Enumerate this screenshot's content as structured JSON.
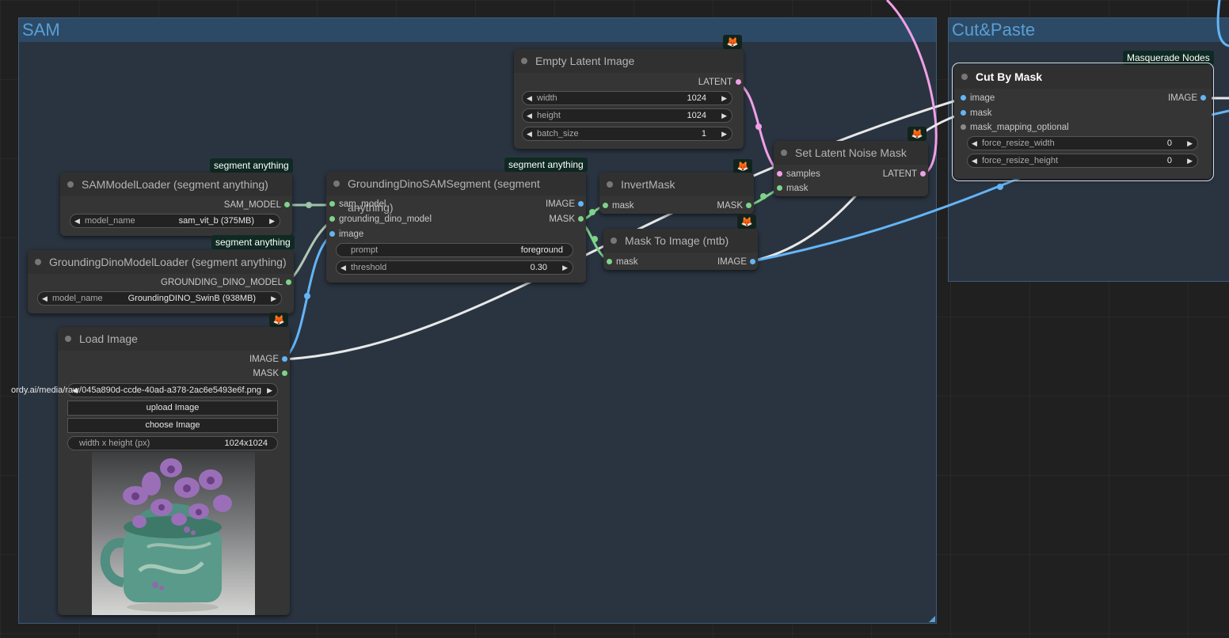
{
  "groups": {
    "sam": {
      "title": "SAM"
    },
    "cutpaste": {
      "title": "Cut&Paste"
    }
  },
  "badges": {
    "segment_anything": "segment anything",
    "masquerade": "Masquerade Nodes"
  },
  "fox_icon": "🦊",
  "arrows": {
    "left": "◀",
    "right": "▶"
  },
  "nodes": {
    "empty_latent": {
      "title": "Empty Latent Image",
      "out_latent": "LATENT",
      "w_width": {
        "label": "width",
        "value": "1024"
      },
      "w_height": {
        "label": "height",
        "value": "1024"
      },
      "w_batch": {
        "label": "batch_size",
        "value": "1"
      }
    },
    "sam_loader": {
      "title": "SAMModelLoader (segment anything)",
      "out": "SAM_MODEL",
      "w_model": {
        "label": "model_name",
        "value": "sam_vit_b (375MB)"
      }
    },
    "dino_loader": {
      "title": "GroundingDinoModelLoader (segment anything)",
      "out": "GROUNDING_DINO_MODEL",
      "w_model": {
        "label": "model_name",
        "value": "GroundingDINO_SwinB (938MB)"
      }
    },
    "dino_sam": {
      "title": "GroundingDinoSAMSegment (segment anything)",
      "in_sam": "sam_model",
      "in_dino": "grounding_dino_model",
      "in_image": "image",
      "out_image": "IMAGE",
      "out_mask": "MASK",
      "w_prompt": {
        "label": "prompt",
        "value": "foreground"
      },
      "w_threshold": {
        "label": "threshold",
        "value": "0.30"
      }
    },
    "invert_mask": {
      "title": "InvertMask",
      "in_mask": "mask",
      "out_mask": "MASK"
    },
    "mask_to_image": {
      "title": "Mask To Image (mtb)",
      "in_mask": "mask",
      "out_image": "IMAGE"
    },
    "set_latent_noise": {
      "title": "Set Latent Noise Mask",
      "in_samples": "samples",
      "in_mask": "mask",
      "out_latent": "LATENT"
    },
    "load_image": {
      "title": "Load Image",
      "out_image": "IMAGE",
      "out_mask": "MASK",
      "w_image": {
        "value": "ordy.ai/media/raw/045a890d-ccde-40ad-a378-2ac6e5493e6f.png"
      },
      "btn_upload": "upload Image",
      "btn_choose": "choose Image",
      "w_size": {
        "label": "width x height (px)",
        "value": "1024x1024"
      }
    },
    "cut_by_mask": {
      "title": "Cut By Mask",
      "in_image": "image",
      "in_mask": "mask",
      "in_mapping": "mask_mapping_optional",
      "out_image": "IMAGE",
      "w_fw": {
        "label": "force_resize_width",
        "value": "0"
      },
      "w_fh": {
        "label": "force_resize_height",
        "value": "0"
      }
    }
  },
  "colors": {
    "canvas": "#202020",
    "group": "#2a3441",
    "group_title": "#5a9fd4",
    "node": "#353535",
    "image_link": "#64b5f6",
    "mask_link": "#7ed38a",
    "latent_link": "#f0a0e8",
    "white_link": "#e8e8e8"
  }
}
